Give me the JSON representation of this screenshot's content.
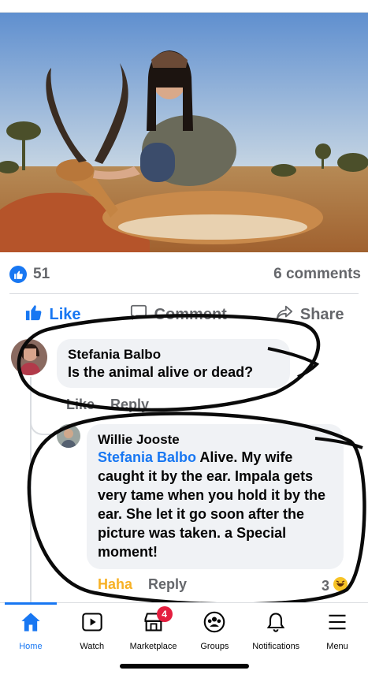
{
  "post": {
    "photo_description_icon": "hunting-photo",
    "reaction_count": "51",
    "comments_label": "6 comments"
  },
  "actions": {
    "like": "Like",
    "comment": "Comment",
    "share": "Share"
  },
  "comments": [
    {
      "author": "Stefania Balbo",
      "text": "Is the animal alive or dead?",
      "like": "Like",
      "reply": "Reply"
    },
    {
      "author": "Willie Jooste",
      "mention": "Stefania Balbo",
      "text": " Alive. My wife caught it by the ear. Impala gets very tame when you hold it by the ear. She let it go soon after the picture was taken. a Special moment!",
      "reaction_label": "Haha",
      "reply": "Reply",
      "reaction_count": "3"
    }
  ],
  "nav": {
    "items": [
      {
        "label": "Home",
        "icon": "home-icon"
      },
      {
        "label": "Watch",
        "icon": "watch-icon"
      },
      {
        "label": "Marketplace",
        "icon": "marketplace-icon",
        "badge": "4"
      },
      {
        "label": "Groups",
        "icon": "groups-icon"
      },
      {
        "label": "Notifications",
        "icon": "bell-icon"
      },
      {
        "label": "Menu",
        "icon": "menu-icon"
      }
    ]
  },
  "colors": {
    "brand_blue": "#1877f2",
    "annotation_ink": "#0a0a0a",
    "badge_red": "#e41e3f"
  }
}
